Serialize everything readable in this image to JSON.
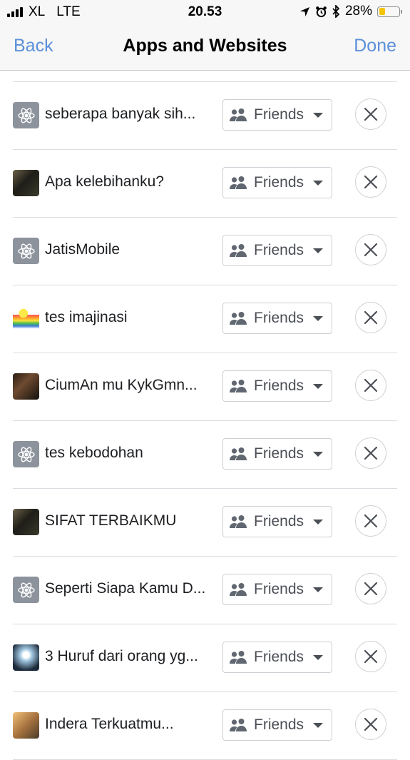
{
  "status_bar": {
    "carrier": "XL",
    "network": "LTE",
    "time": "20.53",
    "battery_percent": "28%",
    "battery_level": 0.28,
    "battery_color": "#f5c400",
    "icons": [
      "signal-bars-icon",
      "location-arrow-icon",
      "alarm-clock-icon",
      "bluetooth-icon",
      "battery-icon"
    ]
  },
  "nav": {
    "back_label": "Back",
    "title": "Apps and Websites",
    "done_label": "Done",
    "link_color": "#5b8fd9"
  },
  "apps": [
    {
      "name": "seberapa banyak sih...",
      "icon": "gear-icon",
      "audience": "Friends"
    },
    {
      "name": "Apa kelebihanku?",
      "icon": "app-thumbnail-dark",
      "audience": "Friends"
    },
    {
      "name": "JatisMobile",
      "icon": "gear-icon",
      "audience": "Friends"
    },
    {
      "name": "tes imajinasi",
      "icon": "app-thumbnail-rainbow",
      "audience": "Friends"
    },
    {
      "name": "CiumAn mu KykGmn...",
      "icon": "app-thumbnail-photo",
      "audience": "Friends"
    },
    {
      "name": "tes kebodohan",
      "icon": "gear-icon",
      "audience": "Friends"
    },
    {
      "name": "SIFAT TERBAIKMU",
      "icon": "app-thumbnail-dark",
      "audience": "Friends"
    },
    {
      "name": "Seperti Siapa Kamu D...",
      "icon": "gear-icon",
      "audience": "Friends"
    },
    {
      "name": "3 Huruf dari orang yg...",
      "icon": "app-thumbnail-blue",
      "audience": "Friends"
    },
    {
      "name": "Indera Terkuatmu...",
      "icon": "app-thumbnail-golden",
      "audience": "Friends"
    }
  ]
}
